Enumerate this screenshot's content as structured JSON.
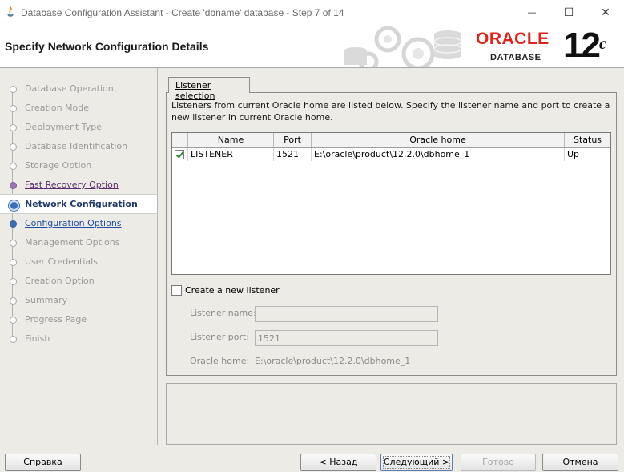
{
  "window": {
    "title": "Database Configuration Assistant - Create 'dbname' database - Step 7 of 14",
    "minimize_glyph": "—",
    "maximize_glyph": "☐",
    "close_glyph": "✕"
  },
  "header": {
    "title": "Specify Network Configuration Details",
    "brand": "ORACLE",
    "brand_sub": "DATABASE",
    "version": "12",
    "version_sup": "c"
  },
  "steps": [
    {
      "label": "Database Operation",
      "state": "done"
    },
    {
      "label": "Creation Mode",
      "state": "done"
    },
    {
      "label": "Deployment Type",
      "state": "done"
    },
    {
      "label": "Database Identification",
      "state": "done"
    },
    {
      "label": "Storage Option",
      "state": "done"
    },
    {
      "label": "Fast Recovery Option",
      "state": "visited"
    },
    {
      "label": "Network Configuration",
      "state": "current"
    },
    {
      "label": "Configuration Options",
      "state": "next"
    },
    {
      "label": "Management Options",
      "state": "pending"
    },
    {
      "label": "User Credentials",
      "state": "pending"
    },
    {
      "label": "Creation Option",
      "state": "pending"
    },
    {
      "label": "Summary",
      "state": "pending"
    },
    {
      "label": "Progress Page",
      "state": "pending"
    },
    {
      "label": "Finish",
      "state": "pending"
    }
  ],
  "tab": {
    "label": "Listener selection"
  },
  "description": "Listeners from current Oracle home are listed below. Specify the listener name and port to create a new listener in current Oracle home.",
  "table": {
    "columns": [
      "Name",
      "Port",
      "Oracle home",
      "Status"
    ],
    "rows": [
      {
        "checked": true,
        "name": "LISTENER",
        "port": "1521",
        "home": "E:\\oracle\\product\\12.2.0\\dbhome_1",
        "status": "Up"
      }
    ]
  },
  "new_listener": {
    "checkbox_label": "Create a new listener",
    "checked": false,
    "name_label": "Listener name:",
    "name_value": "",
    "port_label": "Listener port:",
    "port_value": "1521",
    "home_label": "Oracle home:",
    "home_value": "E:\\oracle\\product\\12.2.0\\dbhome_1"
  },
  "buttons": {
    "help": "Справка",
    "back": "< Назад",
    "next": "Следующий >",
    "finish": "Готово",
    "cancel": "Отмена"
  },
  "colors": {
    "oracle_red": "#e0221a",
    "current_step": "#1e3b6b",
    "visited_step": "#5d2f6e",
    "next_step": "#1f4ea0",
    "check_green": "#2e8b2e"
  }
}
